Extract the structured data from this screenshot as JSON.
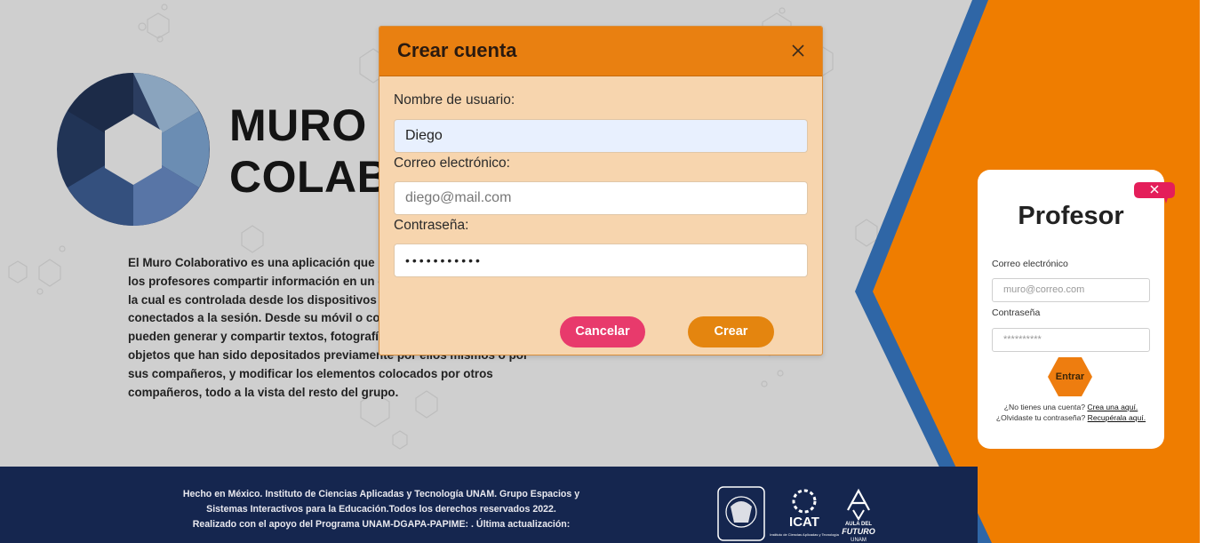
{
  "brand": {
    "title_line1": "MURO",
    "title_line2": "COLAB"
  },
  "intro": {
    "text": "El Muro Colaborativo es una aplicación que ... los profesores compartir información en un ... la cual es controlada desde los dispositivos ... conectados a la sesión. Desde su móvil o co... pueden generar y compartir textos, fotografí... objetos que han sido depositados previamente por ellos mismos o por sus compañeros, y modificar los elementos colocados por otros compañeros, todo a la vista del resto del grupo.",
    "lines": [
      "El Muro Colaborativo es una aplicación que",
      "los profesores compartir información en un c",
      "la cual es controlada desde los dispositivos p",
      "conectados a la sesión. Desde su móvil o co",
      "pueden generar y compartir textos, fotografí",
      "objetos que han sido depositados previamente por ellos mismos o por",
      "sus compañeros, y modificar los elementos colocados por otros",
      "compañeros, todo a la vista del resto del grupo."
    ]
  },
  "footer": {
    "line1": "Hecho en México. Instituto de Ciencias Aplicadas y Tecnología UNAM. Grupo Espacios y",
    "line2": "Sistemas Interactivos para la Educación.Todos los derechos reservados 2022.",
    "line3": "Realizado con el apoyo del Programa UNAM-DGAPA-PAPIME: . Última actualización:",
    "logos": {
      "unam": "unam-seal-icon",
      "icat": "ICAT",
      "icat_sub": "Instituto de Ciencias Aplicadas y Tecnología",
      "aula_line1": "AULA DEL",
      "aula_line2": "FUTURO",
      "aula_line3": "UNAM"
    }
  },
  "modal": {
    "title": "Crear cuenta",
    "username_label": "Nombre de usuario:",
    "username_value": "Diego",
    "email_label": "Correo electrónico:",
    "email_placeholder": "diego@mail.com",
    "password_label": "Contraseña:",
    "password_value": "•••••••••••",
    "cancel_label": "Cancelar",
    "create_label": "Crear"
  },
  "login": {
    "title": "Profesor",
    "email_label": "Correo electrónico",
    "email_placeholder": "muro@correo.com",
    "password_label": "Contraseña",
    "password_placeholder": "**********",
    "submit_label": "Entrar",
    "no_account": "¿No tienes una cuenta?",
    "create_link": "Crea una aquí.",
    "forgot": "¿Olvidaste tu contraseña?",
    "recover_link": "Recupérala aquí."
  },
  "colors": {
    "orange": "#ef7d00",
    "blue_stripe": "#2f66a6",
    "footer_navy": "#15264f",
    "modal_header": "#e98011",
    "modal_body": "#f7d5ae",
    "cancel": "#e83a6c",
    "create": "#e4850f"
  }
}
